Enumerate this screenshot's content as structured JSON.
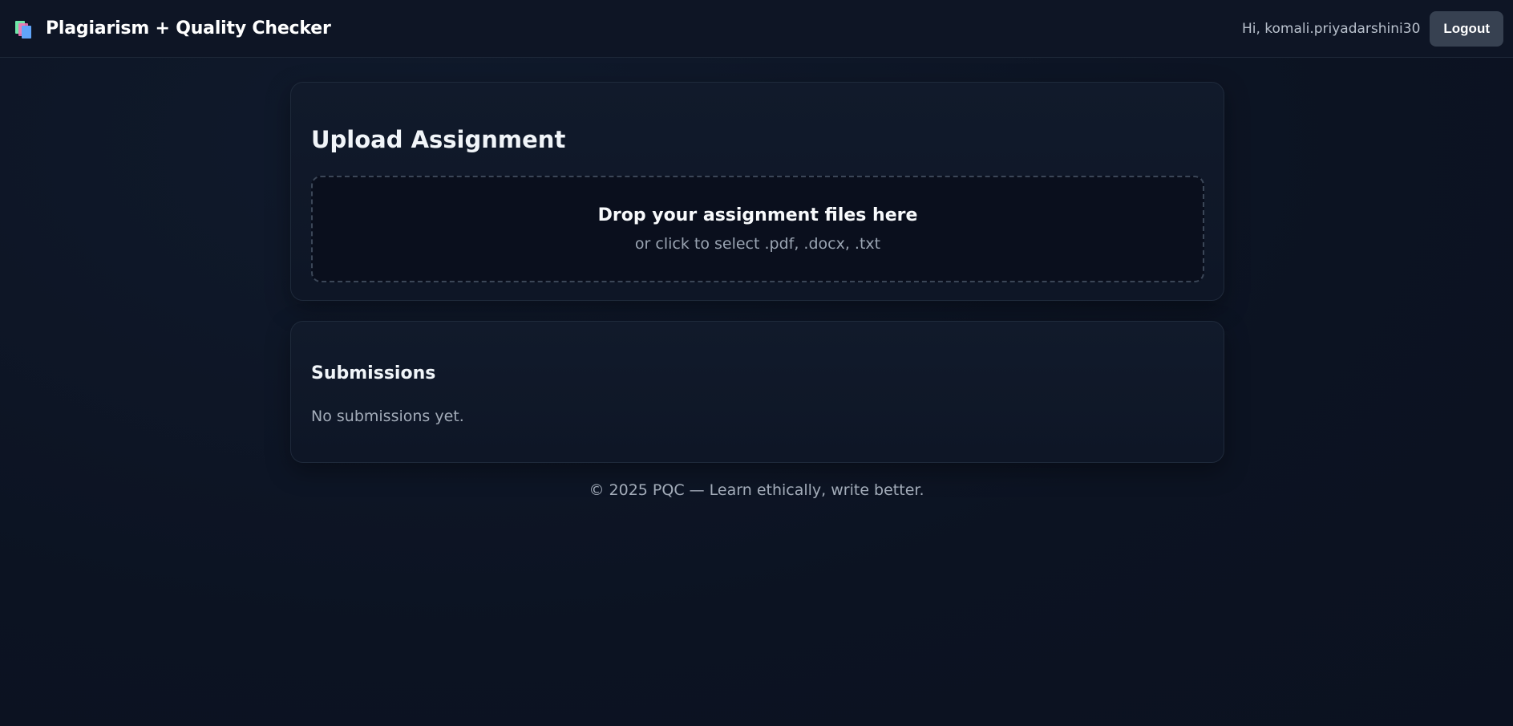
{
  "header": {
    "brand_icon": "books-icon",
    "title": "Plagiarism + Quality Checker",
    "greeting": "Hi, komali.priyadarshini30",
    "logout_label": "Logout"
  },
  "upload": {
    "title": "Upload Assignment",
    "drop_title": "Drop your assignment files here",
    "drop_subtitle": "or click to select .pdf, .docx, .txt"
  },
  "submissions": {
    "title": "Submissions",
    "empty_text": "No submissions yet."
  },
  "footer": {
    "text": "© 2025 PQC — Learn ethically, write better."
  },
  "colors": {
    "background": "#0d1424",
    "card": "#111a2b",
    "logout_button": "#374151",
    "text_primary": "#f1f5f9",
    "text_muted": "#a3acb9"
  }
}
